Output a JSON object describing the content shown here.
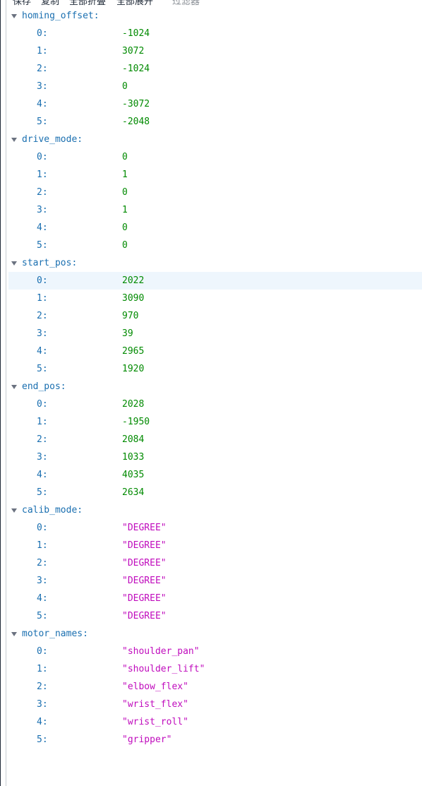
{
  "toolbar": {
    "save_label": "保存",
    "copy_label": "复制",
    "collapse_all_label": "全部折叠",
    "expand_all_label": "全部展开",
    "filter_placeholder": "过滤器"
  },
  "sections": [
    {
      "key": "homing_offset:",
      "type": "number",
      "items": [
        {
          "index": "0:",
          "value": "-1024"
        },
        {
          "index": "1:",
          "value": "3072"
        },
        {
          "index": "2:",
          "value": "-1024"
        },
        {
          "index": "3:",
          "value": "0"
        },
        {
          "index": "4:",
          "value": "-3072"
        },
        {
          "index": "5:",
          "value": "-2048"
        }
      ]
    },
    {
      "key": "drive_mode:",
      "type": "number",
      "items": [
        {
          "index": "0:",
          "value": "0"
        },
        {
          "index": "1:",
          "value": "1"
        },
        {
          "index": "2:",
          "value": "0"
        },
        {
          "index": "3:",
          "value": "1"
        },
        {
          "index": "4:",
          "value": "0"
        },
        {
          "index": "5:",
          "value": "0"
        }
      ]
    },
    {
      "key": "start_pos:",
      "type": "number",
      "highlighted_index": 0,
      "items": [
        {
          "index": "0:",
          "value": "2022"
        },
        {
          "index": "1:",
          "value": "3090"
        },
        {
          "index": "2:",
          "value": "970"
        },
        {
          "index": "3:",
          "value": "39"
        },
        {
          "index": "4:",
          "value": "2965"
        },
        {
          "index": "5:",
          "value": "1920"
        }
      ]
    },
    {
      "key": "end_pos:",
      "type": "number",
      "items": [
        {
          "index": "0:",
          "value": "2028"
        },
        {
          "index": "1:",
          "value": "-1950"
        },
        {
          "index": "2:",
          "value": "2084"
        },
        {
          "index": "3:",
          "value": "1033"
        },
        {
          "index": "4:",
          "value": "4035"
        },
        {
          "index": "5:",
          "value": "2634"
        }
      ]
    },
    {
      "key": "calib_mode:",
      "type": "string",
      "items": [
        {
          "index": "0:",
          "value": "\"DEGREE\""
        },
        {
          "index": "1:",
          "value": "\"DEGREE\""
        },
        {
          "index": "2:",
          "value": "\"DEGREE\""
        },
        {
          "index": "3:",
          "value": "\"DEGREE\""
        },
        {
          "index": "4:",
          "value": "\"DEGREE\""
        },
        {
          "index": "5:",
          "value": "\"DEGREE\""
        }
      ]
    },
    {
      "key": "motor_names:",
      "type": "string",
      "items": [
        {
          "index": "0:",
          "value": "\"shoulder_pan\""
        },
        {
          "index": "1:",
          "value": "\"shoulder_lift\""
        },
        {
          "index": "2:",
          "value": "\"elbow_flex\""
        },
        {
          "index": "3:",
          "value": "\"wrist_flex\""
        },
        {
          "index": "4:",
          "value": "\"wrist_roll\""
        },
        {
          "index": "5:",
          "value": "\"gripper\""
        }
      ]
    }
  ],
  "colors": {
    "key": "#1a6fb0",
    "number": "#008a00",
    "string": "#c00cbd",
    "highlight_row": "#eef6fd",
    "twisty": "#6b7280"
  },
  "icons": {
    "section_toggle": "triangle-down-icon"
  }
}
